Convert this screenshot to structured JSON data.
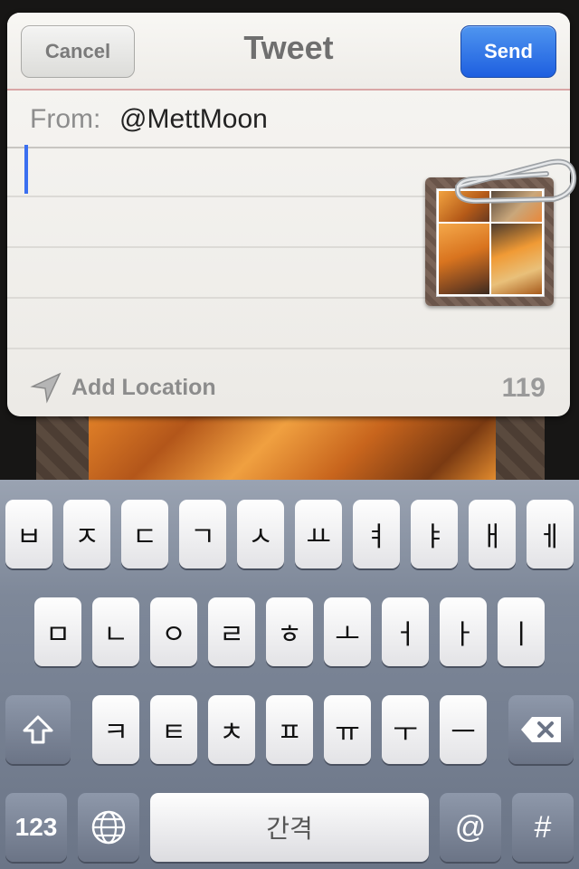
{
  "sheet": {
    "cancel_label": "Cancel",
    "title": "Tweet",
    "send_label": "Send",
    "from_label": "From:",
    "from_value": "@MettMoon",
    "add_location_label": "Add Location",
    "char_count": "119"
  },
  "keyboard": {
    "row1": [
      "ㅂ",
      "ㅈ",
      "ㄷ",
      "ㄱ",
      "ㅅ",
      "ㅛ",
      "ㅕ",
      "ㅑ",
      "ㅐ",
      "ㅔ"
    ],
    "row2": [
      "ㅁ",
      "ㄴ",
      "ㅇ",
      "ㄹ",
      "ㅎ",
      "ㅗ",
      "ㅓ",
      "ㅏ",
      "ㅣ"
    ],
    "row3": [
      "ㅋ",
      "ㅌ",
      "ㅊ",
      "ㅍ",
      "ㅠ",
      "ㅜ",
      "ㅡ"
    ],
    "numbers_label": "123",
    "space_label": "간격",
    "at_label": "@",
    "hash_label": "#"
  },
  "icons": {
    "location": "location-arrow-icon",
    "paperclip": "paperclip-icon",
    "shift": "shift-icon",
    "backspace": "backspace-icon",
    "globe": "globe-icon"
  },
  "colors": {
    "send_button": "#2a6fe8",
    "cursor": "#3b6ff0"
  }
}
